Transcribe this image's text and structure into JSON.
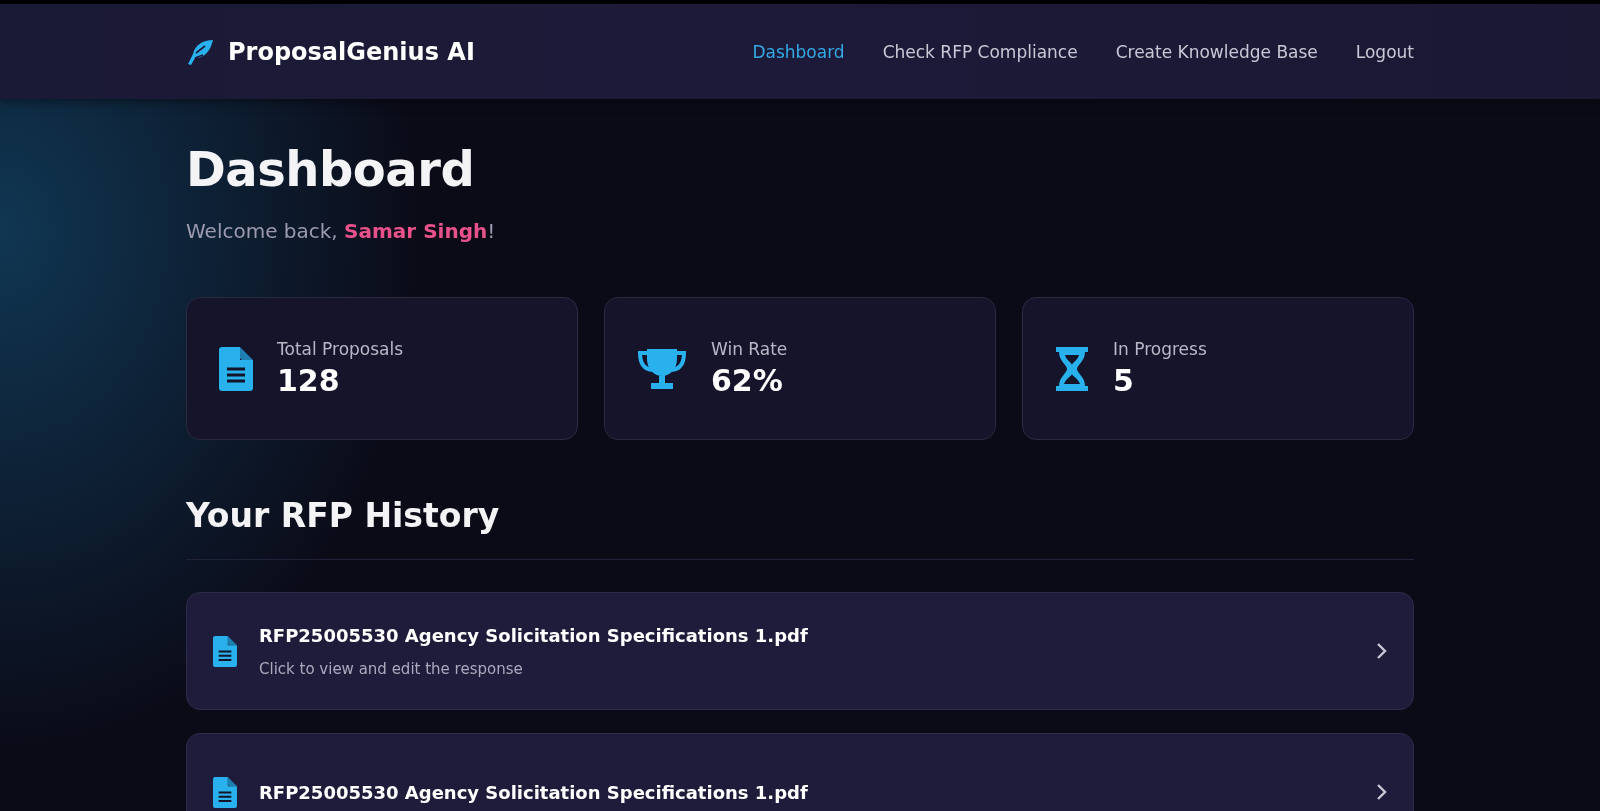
{
  "header": {
    "brand": "ProposalGenius AI",
    "nav": [
      {
        "label": "Dashboard",
        "selected": true
      },
      {
        "label": "Check RFP Compliance",
        "selected": false
      },
      {
        "label": "Create Knowledge Base",
        "selected": false
      },
      {
        "label": "Logout",
        "selected": false
      }
    ]
  },
  "page": {
    "title": "Dashboard",
    "welcome_prefix": "Welcome back, ",
    "user_name": "Samar Singh",
    "welcome_suffix": "!"
  },
  "stats": [
    {
      "kind": "document",
      "label": "Total Proposals",
      "value": "128"
    },
    {
      "kind": "trophy",
      "label": "Win Rate",
      "value": "62%"
    },
    {
      "kind": "hourglass",
      "label": "In Progress",
      "value": "5"
    }
  ],
  "history": {
    "title": "Your RFP History",
    "items": [
      {
        "title": "RFP25005530 Agency Solicitation Specifications 1.pdf",
        "subtitle": "Click to view and edit the response"
      },
      {
        "title": "RFP25005530 Agency Solicitation Specifications 1.pdf"
      }
    ]
  }
}
